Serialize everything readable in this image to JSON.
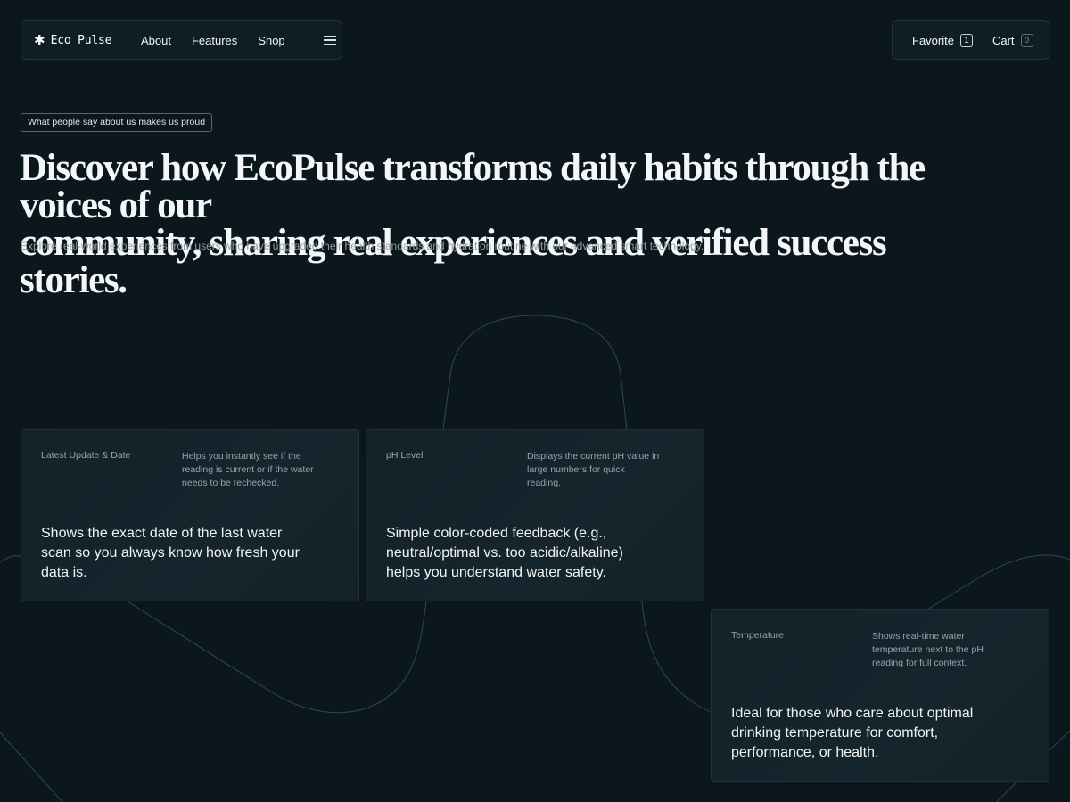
{
  "brand": {
    "name": "Eco Pulse",
    "icon": "asterisk-icon"
  },
  "nav": {
    "links": [
      "About",
      "Features",
      "Shop"
    ],
    "menu_icon": "hamburger-icon"
  },
  "actions": {
    "favorite": {
      "label": "Favorite",
      "count": "1"
    },
    "cart": {
      "label": "Cart",
      "count": "0"
    }
  },
  "hero": {
    "eyebrow": "What people say about us makes us proud",
    "headline_line1": "Discover how EcoPulse transforms daily habits through the voices of our",
    "headline_line2": "community, sharing real experiences and verified success stories.",
    "subtitle": "Explore real-world experiences from users who have upgraded their health standards and hydration routine with our advanced smart technology."
  },
  "cards": [
    {
      "label": "Latest Update & Date",
      "note": "Helps you instantly see if the reading is current or if the water needs to be rechecked.",
      "body": "Shows the exact date of the last water scan so you always know how fresh your data is."
    },
    {
      "label": "pH Level",
      "note": "Displays the current pH value in large numbers for quick reading.",
      "body": "Simple color-coded feedback (e.g., neutral/optimal vs. too acidic/alkaline) helps you understand water safety."
    },
    {
      "label": "Temperature",
      "note": "Shows real-time water temperature next to the pH reading for full context.",
      "body": "Ideal for those who care about optimal drinking temperature for comfort, performance, or health."
    }
  ],
  "colors": {
    "background": "#0b171d",
    "line": "#2a4a55",
    "text": "#f4f6f7",
    "muted": "#96a5ab"
  }
}
